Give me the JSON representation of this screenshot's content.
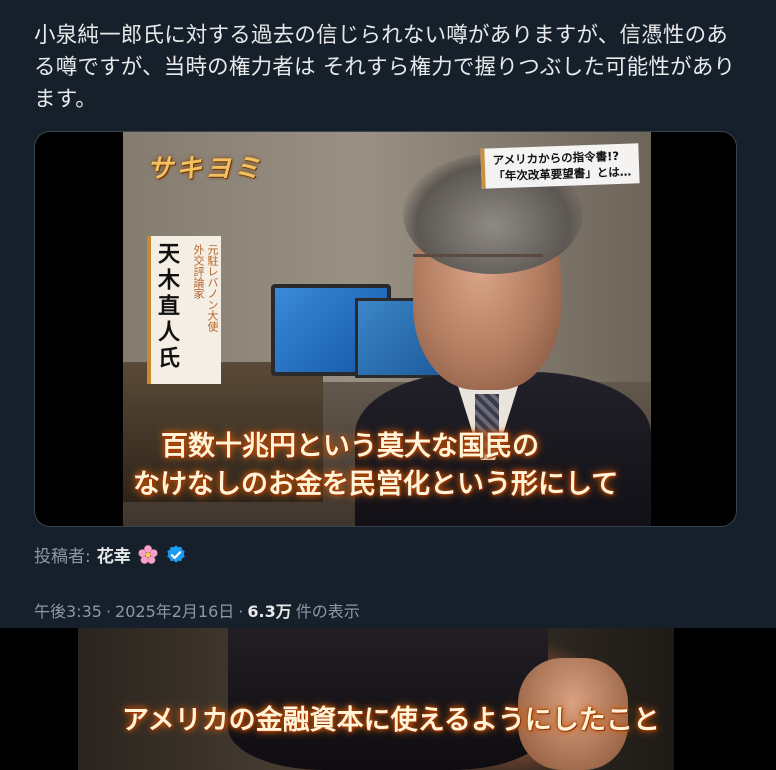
{
  "tweet": {
    "text": "小泉純一郎氏に対する過去の信じられない噂がありますが、信憑性のある噂ですが、当時の権力者は それすら権力で握りつぶした可能性があります。",
    "byline_prefix": "投稿者:",
    "author": "花幸",
    "author_emoji": "cherry-blossom-icon",
    "verified_icon": "verified-badge-icon",
    "accent_color": "#1d9bf0",
    "time": "午後3:35",
    "date": "2025年2月16日",
    "views_count": "6.3万",
    "views_suffix": "件の表示"
  },
  "media": {
    "logo": "サキヨミ",
    "topic_line1": "アメリカからの指令書!?",
    "topic_line2": "「年次改革要望書」とは…",
    "person_name": "天木直人氏",
    "person_role_1": "外交評論家",
    "person_role_2": "元駐レバノン大使",
    "subtitle_1": "百数十兆円という莫大な国民の",
    "subtitle_2": "なけなしのお金を民営化という形にして"
  },
  "bottom_clip": {
    "subtitle": "アメリカの金融資本に使えるようにしたこと"
  }
}
